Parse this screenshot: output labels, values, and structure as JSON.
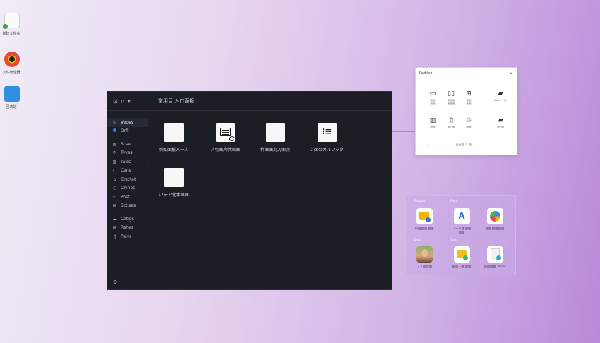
{
  "desktop": {
    "icons": [
      {
        "label": "新建文件夹",
        "icon": "file-icon"
      },
      {
        "label": "文件管理器",
        "icon": "chrome-icon"
      },
      {
        "label": "回收站",
        "icon": "folder-icon"
      }
    ]
  },
  "window": {
    "title": "常用目 入口面板",
    "controls": [
      "⊡",
      "∩",
      "▾"
    ],
    "sidebar": {
      "primary": [
        {
          "label": "Vedes",
          "icon": "◎",
          "active": true
        },
        {
          "label": "Drft",
          "icon": "dot"
        }
      ],
      "secondary": [
        {
          "label": "Scsel",
          "icon": "▤"
        },
        {
          "label": "Tyyes",
          "icon": "⟳"
        },
        {
          "label": "Taiss",
          "icon": "▥"
        },
        {
          "label": "Cans",
          "icon": "▢"
        },
        {
          "label": "Crsctot",
          "icon": "⌂"
        },
        {
          "label": "Chines",
          "icon": "○"
        },
        {
          "label": "Post",
          "icon": "▭"
        },
        {
          "label": "Sctlses",
          "icon": "▤"
        }
      ],
      "tertiary": [
        {
          "label": "Catigs",
          "icon": "☁"
        },
        {
          "label": "Rshes",
          "icon": "▤"
        },
        {
          "label": "Paivs",
          "icon": "♫"
        }
      ],
      "bottom_icon": "⚙"
    },
    "grid": [
      {
        "label": "例如面板入一人",
        "tile": "blank"
      },
      {
        "label": "ア用面片供画面",
        "tile": "document"
      },
      {
        "label": "料面面儿刀面用",
        "tile": "blank"
      },
      {
        "label": "ク面のカルフッタ",
        "tile": "list"
      },
      {
        "label": "17テア化本面面",
        "tile": "blank"
      }
    ]
  },
  "popup": {
    "title": "Padrive",
    "close": "×",
    "items": [
      {
        "glyph": "▭",
        "text": [
          "面板",
          "面面"
        ]
      },
      {
        "glyph": "▯▯",
        "text": [
          "面面面",
          "面面面"
        ]
      },
      {
        "glyph": "⊞",
        "text": [
          "面面",
          "面面"
        ]
      },
      {
        "glyph": "▰",
        "text": [
          ""
        ]
      },
      {
        "glyph": "▰",
        "text": [
          "Nornp P1e"
        ]
      },
      {
        "glyph": "▥",
        "text": [
          "面面"
        ]
      },
      {
        "glyph": "♫",
        "text": [
          "面ア面"
        ]
      },
      {
        "glyph": "♲",
        "text": [
          "面面"
        ]
      },
      {
        "glyph": "▰",
        "text": [
          ""
        ]
      },
      {
        "glyph": "▰",
        "text": [
          "面P4d"
        ]
      }
    ],
    "footer": {
      "left": "4",
      "right": "面面面 ハ 面"
    }
  },
  "launcher": {
    "sections": [
      "Plopter",
      "Pact",
      "Dott",
      "Tust"
    ],
    "apps": [
      {
        "label": "日面面面面面",
        "icon": "ai-note"
      },
      {
        "label": "フォル面面面",
        "sub": "面面",
        "icon": "ai-store"
      },
      {
        "label": "面面面面面面",
        "icon": "ai-ball"
      },
      {
        "label": "フフ面面面",
        "icon": "ai-face"
      },
      {
        "label": "画面下面面面",
        "icon": "ai-pad"
      },
      {
        "label": "面面面面 Pirioc",
        "icon": "ai-doc"
      }
    ]
  }
}
